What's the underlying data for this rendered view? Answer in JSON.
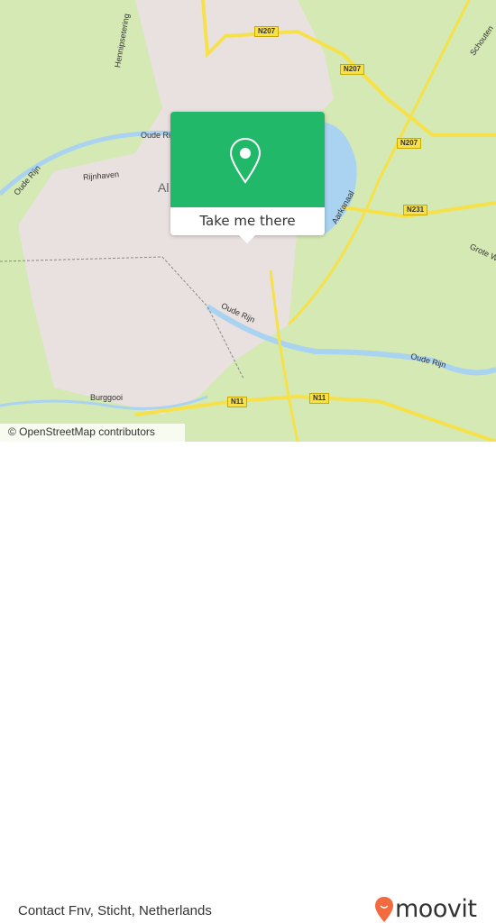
{
  "map": {
    "road_labels": [
      "N207",
      "N207",
      "N207",
      "N231",
      "N11",
      "N11"
    ],
    "street_labels": [
      "Oude Rijn",
      "Oude Rijn",
      "Oude Rijn",
      "Oude Rijn",
      "Rijnhaven",
      "Burggooi",
      "Aarkanaal",
      "Grote W",
      "Hennipsetering",
      "Schouten"
    ],
    "place_label": "Al",
    "attribution": "© OpenStreetMap contributors",
    "colors": {
      "land": "#d4e9b4",
      "urban": "#e9e1df",
      "water": "#a9d3f0",
      "road": "#f7e14b"
    }
  },
  "popup": {
    "icon": "map-pin-icon",
    "button_label": "Take me there",
    "color": "#22b86a"
  },
  "footer": {
    "place_name": "Contact Fnv, Sticht, Netherlands",
    "logo_text": "moovit",
    "logo_color": "#f26a3d"
  }
}
